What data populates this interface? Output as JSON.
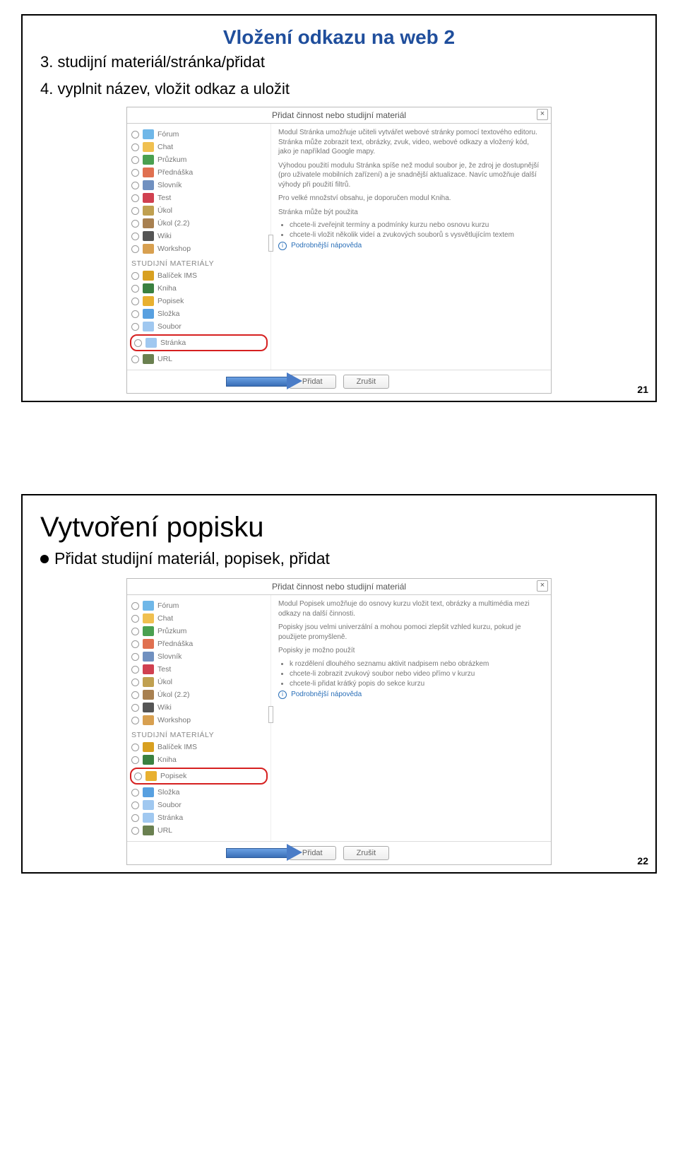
{
  "slide1": {
    "title": "Vložení odkazu na web 2",
    "step3": "3. studijní materiál/stránka/přidat",
    "step4": "4. vyplnit název, vložit odkaz a uložit",
    "page": "21"
  },
  "slide2": {
    "title": "Vytvoření popisku",
    "bullet": "Přidat studijní materiál, popisek, přidat",
    "page": "22"
  },
  "dialog": {
    "header": "Přidat činnost nebo studijní materiál",
    "close": "×",
    "section": "STUDIJNÍ MATERIÁLY",
    "activities": [
      "Fórum",
      "Chat",
      "Průzkum",
      "Přednáška",
      "Slovník",
      "Test",
      "Úkol",
      "Úkol (2.2)",
      "Wiki",
      "Workshop"
    ],
    "materials1": [
      "Balíček IMS",
      "Kniha",
      "Popisek",
      "Složka",
      "Soubor",
      "Stránka",
      "URL"
    ],
    "materials2": [
      "Balíček IMS",
      "Kniha",
      "Popisek",
      "Složka",
      "Soubor",
      "Stránka",
      "URL"
    ],
    "help": "Podrobnější nápověda",
    "btn_add": "Přidat",
    "btn_cancel": "Zrušit",
    "desc_stranka": {
      "p1": "Modul Stránka umožňuje učiteli vytvářet webové stránky pomocí textového editoru. Stránka může zobrazit text, obrázky, zvuk, video, webové odkazy a vložený kód, jako je například Google mapy.",
      "p2": "Výhodou použití modulu Stránka spíše než modul soubor je, že zdroj je dostupnější (pro uživatele mobilních zařízení) a je snadnější aktualizace. Navíc umožňuje další výhody při použití filtrů.",
      "p3": "Pro velké množství obsahu, je doporučen modul Kniha.",
      "p4": "Stránka může být použita",
      "li1": "chcete-li zveřejnit termíny a podmínky kurzu nebo osnovu kurzu",
      "li2": "chcete-li vložit několik videí a zvukových souborů s vysvětlujícím textem"
    },
    "desc_popisek": {
      "p1": "Modul Popisek umožňuje do osnovy kurzu vložit text, obrázky a multimédia mezi odkazy na další činnosti.",
      "p2": "Popisky jsou velmi univerzální a mohou pomoci zlepšit vzhled kurzu, pokud je použijete promyšleně.",
      "p3": "Popisky je možno použít",
      "li1": "k rozdělení dlouhého seznamu aktivit nadpisem nebo obrázkem",
      "li2": "chcete-li zobrazit zvukový soubor nebo video přímo v kurzu",
      "li3": "chcete-li přidat krátký popis do sekce kurzu"
    }
  },
  "icons": {
    "forum": "#6fb7e8",
    "chat": "#f0c050",
    "pruzkum": "#4aa050",
    "prednaska": "#e07050",
    "slovnik": "#7090c0",
    "test": "#d04050",
    "ukol": "#c0a050",
    "ukol22": "#a88050",
    "wiki": "#555",
    "workshop": "#d8a050",
    "balicek": "#d8a020",
    "kniha": "#3a8040",
    "popisek": "#e8b030",
    "slozka": "#58a0e0",
    "soubor": "#a0c8f0",
    "stranka": "#a0c8f0",
    "url": "#6a8050"
  }
}
